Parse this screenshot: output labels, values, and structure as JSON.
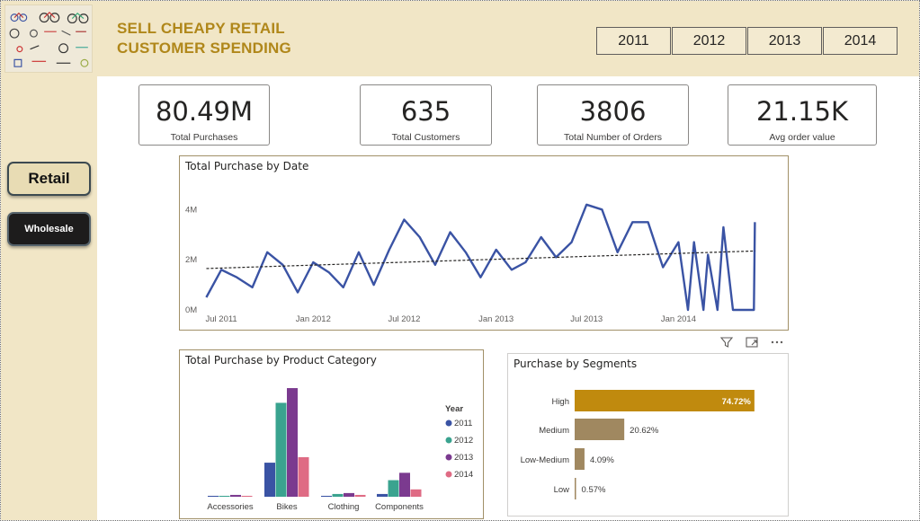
{
  "app": {
    "title_line1": "SELL CHEAPY RETAIL",
    "title_line2": "CUSTOMER SPENDING"
  },
  "years": [
    "2011",
    "2012",
    "2013",
    "2014"
  ],
  "nav": {
    "retail": "Retail",
    "wholesale": "Wholesale"
  },
  "kpis": [
    {
      "value": "80.49M",
      "label": "Total Purchases"
    },
    {
      "value": "635",
      "label": "Total Customers"
    },
    {
      "value": "3806",
      "label": "Total Number of Orders"
    },
    {
      "value": "21.15K",
      "label": "Avg order value"
    }
  ],
  "colors": {
    "accent_gold": "#b0871a",
    "header_bg": "#f1e6c6",
    "line_blue": "#3a53a4",
    "year_2011": "#3a53a4",
    "year_2012": "#3aa38f",
    "year_2013": "#7b3a8f",
    "year_2014": "#df6b84",
    "seg_high": "#c08a0e",
    "seg_other": "#a08860"
  },
  "visual_header_icons": [
    "filter-icon",
    "focus-mode-icon",
    "more-options-icon"
  ],
  "chart_data": [
    {
      "type": "line",
      "title": "Total Purchase by Date",
      "x_ticks": [
        "Jul 2011",
        "Jan 2012",
        "Jul 2012",
        "Jan 2013",
        "Jul 2013",
        "Jan 2014"
      ],
      "y_ticks": [
        "0M",
        "2M",
        "4M"
      ],
      "ylim": [
        0,
        4800000
      ],
      "x_range": [
        "2011-05-15",
        "2014-07-10"
      ],
      "series": [
        {
          "points": [
            [
              "2011-06-01",
              500000
            ],
            [
              "2011-07-01",
              1600000
            ],
            [
              "2011-08-01",
              1300000
            ],
            [
              "2011-09-01",
              900000
            ],
            [
              "2011-10-01",
              2300000
            ],
            [
              "2011-11-01",
              1800000
            ],
            [
              "2011-12-01",
              700000
            ],
            [
              "2012-01-01",
              1900000
            ],
            [
              "2012-02-01",
              1500000
            ],
            [
              "2012-03-01",
              900000
            ],
            [
              "2012-04-01",
              2300000
            ],
            [
              "2012-05-01",
              1000000
            ],
            [
              "2012-06-01",
              2400000
            ],
            [
              "2012-07-01",
              3600000
            ],
            [
              "2012-08-01",
              2900000
            ],
            [
              "2012-09-01",
              1800000
            ],
            [
              "2012-10-01",
              3100000
            ],
            [
              "2012-11-01",
              2300000
            ],
            [
              "2012-12-01",
              1300000
            ],
            [
              "2013-01-01",
              2400000
            ],
            [
              "2013-02-01",
              1600000
            ],
            [
              "2013-03-01",
              1900000
            ],
            [
              "2013-04-01",
              2900000
            ],
            [
              "2013-05-01",
              2100000
            ],
            [
              "2013-06-01",
              2700000
            ],
            [
              "2013-07-01",
              4200000
            ],
            [
              "2013-08-01",
              4000000
            ],
            [
              "2013-09-01",
              2300000
            ],
            [
              "2013-10-01",
              3500000
            ],
            [
              "2013-11-01",
              3500000
            ],
            [
              "2013-12-01",
              1700000
            ],
            [
              "2014-01-01",
              2700000
            ],
            [
              "2014-01-20",
              0
            ],
            [
              "2014-02-01",
              2700000
            ],
            [
              "2014-02-20",
              0
            ],
            [
              "2014-03-01",
              2200000
            ],
            [
              "2014-03-20",
              0
            ],
            [
              "2014-04-01",
              3300000
            ],
            [
              "2014-04-20",
              0
            ],
            [
              "2014-06-01",
              0
            ],
            [
              "2014-06-03",
              3500000
            ]
          ]
        }
      ],
      "trendline": {
        "start": [
          "2011-06-01",
          1650000
        ],
        "end": [
          "2014-06-03",
          2350000
        ]
      }
    },
    {
      "type": "bar",
      "title": "Total Purchase by Product Category",
      "categories": [
        "Accessories",
        "Bikes",
        "Clothing",
        "Components"
      ],
      "legend_title": "Year",
      "ylim": [
        0,
        120
      ],
      "series": [
        {
          "name": "2011",
          "values": [
            1,
            37,
            1,
            3
          ]
        },
        {
          "name": "2012",
          "values": [
            1,
            102,
            3,
            18
          ]
        },
        {
          "name": "2013",
          "values": [
            2,
            118,
            4,
            26
          ]
        },
        {
          "name": "2014",
          "values": [
            1,
            43,
            2,
            8
          ]
        }
      ]
    },
    {
      "type": "bar",
      "orientation": "horizontal",
      "title": "Purchase by Segments",
      "categories": [
        "High",
        "Medium",
        "Low-Medium",
        "Low"
      ],
      "values": [
        74.72,
        20.62,
        4.09,
        0.57
      ],
      "labels": [
        "74.72%",
        "20.62%",
        "4.09%",
        "0.57%"
      ],
      "xlim": [
        0,
        80
      ]
    }
  ]
}
